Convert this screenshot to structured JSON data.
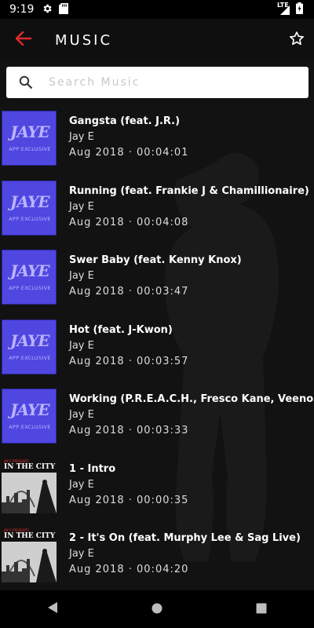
{
  "status_bar": {
    "time": "9:19",
    "network": "LTE"
  },
  "app_bar": {
    "title": "MUSIC"
  },
  "search": {
    "placeholder": "Search Music"
  },
  "tracks": [
    {
      "title": "Gangsta (feat. J.R.)",
      "artist": "Jay E",
      "date": "Aug 2018",
      "duration": "00:04:01",
      "art": "jaye"
    },
    {
      "title": "Running (feat. Frankie J & Chamillionaire)",
      "artist": "Jay E",
      "date": "Aug 2018",
      "duration": "00:04:08",
      "art": "jaye"
    },
    {
      "title": "Swer Baby (feat. Kenny Knox)",
      "artist": "Jay E",
      "date": "Aug 2018",
      "duration": "00:03:47",
      "art": "jaye"
    },
    {
      "title": "Hot (feat. J-Kwon)",
      "artist": "Jay E",
      "date": "Aug 2018",
      "duration": "00:03:57",
      "art": "jaye"
    },
    {
      "title": "Working (P.R.E.A.C.H., Fresco Kane, Veeno Gunna)",
      "artist": "Jay E",
      "date": "Aug 2018",
      "duration": "00:03:33",
      "art": "jaye"
    },
    {
      "title": "1 - Intro",
      "artist": "Jay E",
      "date": "Aug 2018",
      "duration": "00:00:35",
      "art": "city"
    },
    {
      "title": "2 - It's On (feat. Murphy Lee & Sag Live)",
      "artist": "Jay E",
      "date": "Aug 2018",
      "duration": "00:04:20",
      "art": "city"
    }
  ],
  "art_text": {
    "jaye_logo": "JAYE",
    "jaye_sub": "APP EXCLUSIVE",
    "city_tag": "JAY E PRESENTS",
    "city_title": "IN THE CITY"
  },
  "colors": {
    "accent": "#d92b2b",
    "art_purple": "#5046e0",
    "background": "#121212"
  }
}
